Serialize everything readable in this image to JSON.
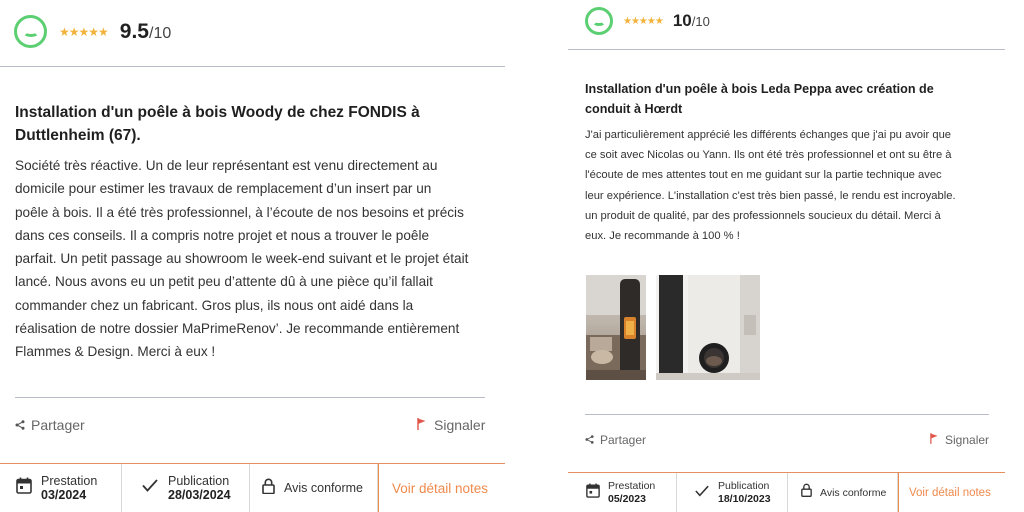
{
  "left_review": {
    "rating": {
      "stars": "★★★★★",
      "score": "9.5",
      "denominator": "/10"
    },
    "title_line1": "Installation d'un poêle à bois Woody de chez FONDIS à",
    "title_line2": "Duttlenheim (67).",
    "body_lines": [
      "Société très réactive. Un de leur représentant est venu directement au",
      "domicile pour estimer les travaux de remplacement d’un insert par un",
      "poêle à bois. Il a été très professionnel, à l’écoute de nos besoins et précis",
      "dans ces conseils. Il a compris notre projet et nous a trouver le poêle",
      "parfait. Un petit passage au showroom le week-end suivant et le projet était",
      "lancé. Nous avons eu un petit peu d’attente dû à une pièce qu’il fallait",
      "commander chez un fabricant. Gros plus, ils nous ont aidé dans la",
      "réalisation de notre dossier MaPrimeRenov’. Je recommande entièrement",
      "Flammes & Design. Merci à eux !"
    ],
    "share_label": "Partager",
    "report_label": "Signaler",
    "footer": {
      "prestation_label": "Prestation",
      "prestation_date": "03/2024",
      "publication_label": "Publication",
      "publication_date": "28/03/2024",
      "conforme_label": "Avis conforme",
      "detail_label": "Voir détail notes"
    }
  },
  "right_review": {
    "rating": {
      "stars": "★★★★★",
      "score": "10",
      "denominator": "/10"
    },
    "title_line1": "Installation d'un poêle à bois Leda Peppa avec création de",
    "title_line2": "conduit à Hœrdt",
    "body_lines": [
      "J'ai particulièrement apprécié les différents échanges que j'ai pu avoir que",
      "ce soit avec Nicolas ou Yann. Ils ont été très professionnel et ont su être à",
      "l'écoute de mes attentes tout en me guidant sur la partie technique avec",
      "leur expérience. L'installation c'est très bien passé, le rendu est incroyable.",
      "un produit de qualité, par des professionnels soucieux du détail. Merci à",
      "eux. Je recommande à 100 % !"
    ],
    "share_label": "Partager",
    "report_label": "Signaler",
    "footer": {
      "prestation_label": "Prestation",
      "prestation_date": "05/2023",
      "publication_label": "Publication",
      "publication_date": "18/10/2023",
      "conforme_label": "Avis conforme",
      "detail_label": "Voir détail notes"
    }
  },
  "icons": {
    "face": "smiley-face-icon",
    "share": "share-icon",
    "flag": "flag-icon",
    "calendar": "calendar-icon",
    "check": "checkmark-icon",
    "lock": "lock-icon"
  },
  "colors": {
    "rating_green": "#5ccf72",
    "star_gold": "#f2b33d",
    "accent_orange": "#ef8a4d",
    "flag_red": "#e0564a",
    "divider": "#b8bcc8"
  }
}
